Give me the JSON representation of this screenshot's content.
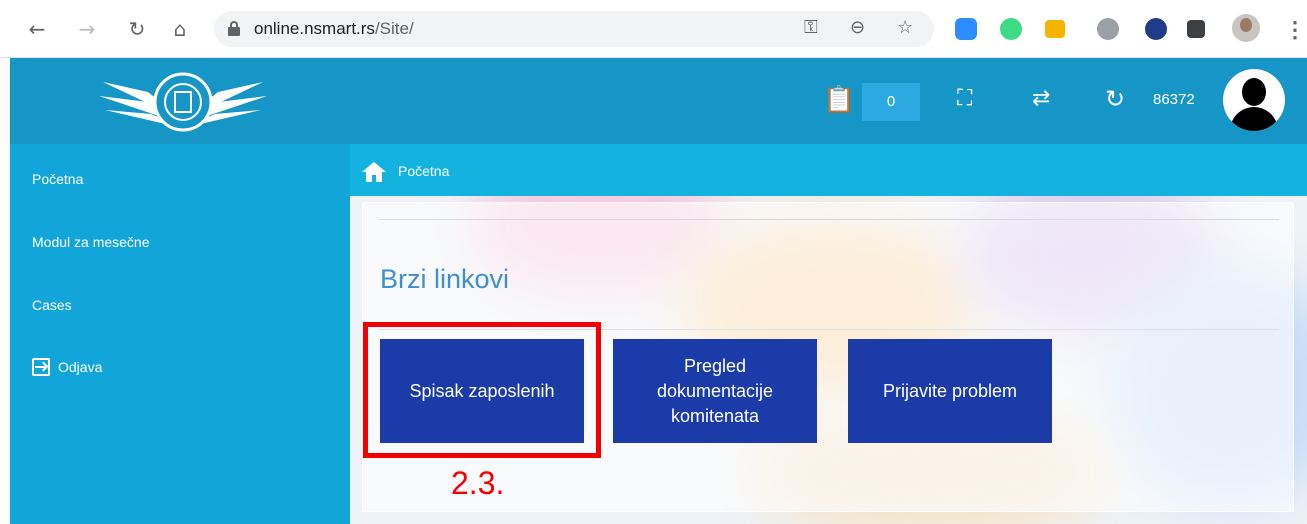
{
  "browser": {
    "url_host": "online.nsmart.rs",
    "url_path": "/Site/"
  },
  "header": {
    "counter": "0",
    "user_number": "86372"
  },
  "sidebar": {
    "items": [
      {
        "label": "Početna"
      },
      {
        "label": "Modul za mesečne"
      },
      {
        "label": "Cases"
      },
      {
        "label": "Odjava"
      }
    ]
  },
  "breadcrumb": {
    "label": "Početna"
  },
  "main": {
    "section_title": "Brzi linkovi",
    "buttons": [
      {
        "label": "Spisak zaposlenih"
      },
      {
        "label": "Pregled dokumentacije komitenata"
      },
      {
        "label": "Prijavite problem"
      }
    ]
  },
  "annotation": {
    "label": "2.3.",
    "color": "#f40000"
  },
  "colors": {
    "header_bg": "#1696c7",
    "sidebar_bg": "#12a5d9",
    "breadcrumb_bg": "#14b3df",
    "button_bg": "#1a3ba8",
    "title_color": "#3e8fcf"
  }
}
